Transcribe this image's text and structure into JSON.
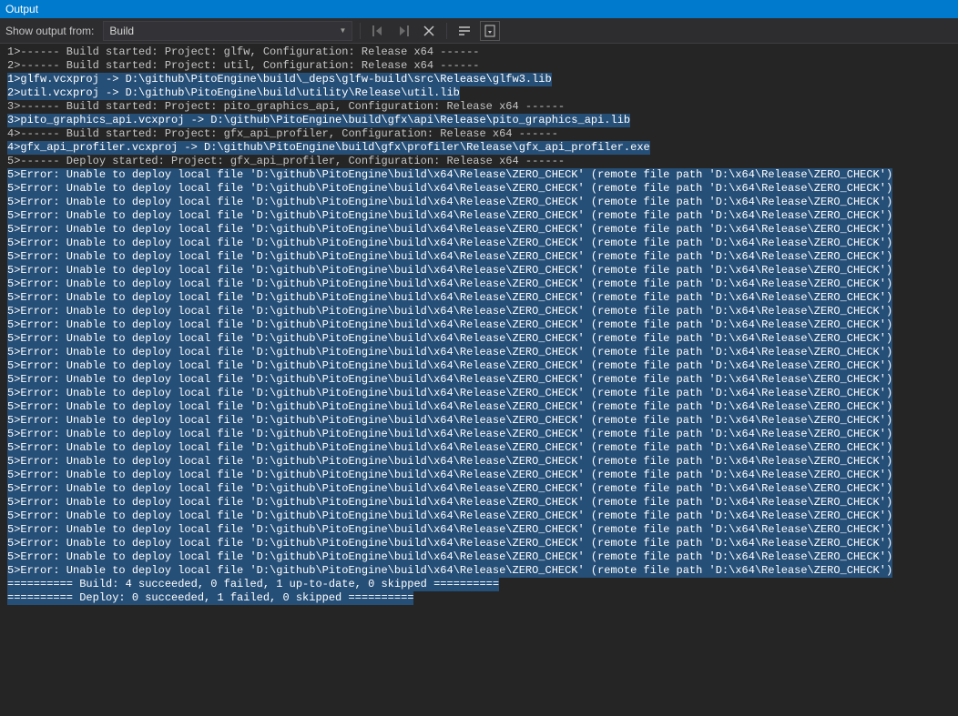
{
  "window": {
    "title": "Output"
  },
  "toolbar": {
    "label": "Show output from:",
    "dropdown_value": "Build"
  },
  "lines": [
    {
      "sel": false,
      "text": "1>------ Build started: Project: glfw, Configuration: Release x64 ------"
    },
    {
      "sel": false,
      "text": "2>------ Build started: Project: util, Configuration: Release x64 ------"
    },
    {
      "sel": true,
      "text": "1>glfw.vcxproj -> D:\\github\\PitoEngine\\build\\_deps\\glfw-build\\src\\Release\\glfw3.lib"
    },
    {
      "sel": true,
      "text": "2>util.vcxproj -> D:\\github\\PitoEngine\\build\\utility\\Release\\util.lib"
    },
    {
      "sel": false,
      "text": "3>------ Build started: Project: pito_graphics_api, Configuration: Release x64 ------"
    },
    {
      "sel": true,
      "text": "3>pito_graphics_api.vcxproj -> D:\\github\\PitoEngine\\build\\gfx\\api\\Release\\pito_graphics_api.lib"
    },
    {
      "sel": false,
      "text": "4>------ Build started: Project: gfx_api_profiler, Configuration: Release x64 ------"
    },
    {
      "sel": true,
      "text": "4>gfx_api_profiler.vcxproj -> D:\\github\\PitoEngine\\build\\gfx\\profiler\\Release\\gfx_api_profiler.exe"
    },
    {
      "sel": false,
      "text": "5>------ Deploy started: Project: gfx_api_profiler, Configuration: Release x64 ------"
    },
    {
      "sel": true,
      "text": "5>Error: Unable to deploy local file 'D:\\github\\PitoEngine\\build\\x64\\Release\\ZERO_CHECK' (remote file path 'D:\\x64\\Release\\ZERO_CHECK')"
    },
    {
      "sel": true,
      "text": "5>Error: Unable to deploy local file 'D:\\github\\PitoEngine\\build\\x64\\Release\\ZERO_CHECK' (remote file path 'D:\\x64\\Release\\ZERO_CHECK')"
    },
    {
      "sel": true,
      "text": "5>Error: Unable to deploy local file 'D:\\github\\PitoEngine\\build\\x64\\Release\\ZERO_CHECK' (remote file path 'D:\\x64\\Release\\ZERO_CHECK')"
    },
    {
      "sel": true,
      "text": "5>Error: Unable to deploy local file 'D:\\github\\PitoEngine\\build\\x64\\Release\\ZERO_CHECK' (remote file path 'D:\\x64\\Release\\ZERO_CHECK')"
    },
    {
      "sel": true,
      "text": "5>Error: Unable to deploy local file 'D:\\github\\PitoEngine\\build\\x64\\Release\\ZERO_CHECK' (remote file path 'D:\\x64\\Release\\ZERO_CHECK')"
    },
    {
      "sel": true,
      "text": "5>Error: Unable to deploy local file 'D:\\github\\PitoEngine\\build\\x64\\Release\\ZERO_CHECK' (remote file path 'D:\\x64\\Release\\ZERO_CHECK')"
    },
    {
      "sel": true,
      "text": "5>Error: Unable to deploy local file 'D:\\github\\PitoEngine\\build\\x64\\Release\\ZERO_CHECK' (remote file path 'D:\\x64\\Release\\ZERO_CHECK')"
    },
    {
      "sel": true,
      "text": "5>Error: Unable to deploy local file 'D:\\github\\PitoEngine\\build\\x64\\Release\\ZERO_CHECK' (remote file path 'D:\\x64\\Release\\ZERO_CHECK')"
    },
    {
      "sel": true,
      "text": "5>Error: Unable to deploy local file 'D:\\github\\PitoEngine\\build\\x64\\Release\\ZERO_CHECK' (remote file path 'D:\\x64\\Release\\ZERO_CHECK')"
    },
    {
      "sel": true,
      "text": "5>Error: Unable to deploy local file 'D:\\github\\PitoEngine\\build\\x64\\Release\\ZERO_CHECK' (remote file path 'D:\\x64\\Release\\ZERO_CHECK')"
    },
    {
      "sel": true,
      "text": "5>Error: Unable to deploy local file 'D:\\github\\PitoEngine\\build\\x64\\Release\\ZERO_CHECK' (remote file path 'D:\\x64\\Release\\ZERO_CHECK')"
    },
    {
      "sel": true,
      "text": "5>Error: Unable to deploy local file 'D:\\github\\PitoEngine\\build\\x64\\Release\\ZERO_CHECK' (remote file path 'D:\\x64\\Release\\ZERO_CHECK')"
    },
    {
      "sel": true,
      "text": "5>Error: Unable to deploy local file 'D:\\github\\PitoEngine\\build\\x64\\Release\\ZERO_CHECK' (remote file path 'D:\\x64\\Release\\ZERO_CHECK')"
    },
    {
      "sel": true,
      "text": "5>Error: Unable to deploy local file 'D:\\github\\PitoEngine\\build\\x64\\Release\\ZERO_CHECK' (remote file path 'D:\\x64\\Release\\ZERO_CHECK')"
    },
    {
      "sel": true,
      "text": "5>Error: Unable to deploy local file 'D:\\github\\PitoEngine\\build\\x64\\Release\\ZERO_CHECK' (remote file path 'D:\\x64\\Release\\ZERO_CHECK')"
    },
    {
      "sel": true,
      "text": "5>Error: Unable to deploy local file 'D:\\github\\PitoEngine\\build\\x64\\Release\\ZERO_CHECK' (remote file path 'D:\\x64\\Release\\ZERO_CHECK')"
    },
    {
      "sel": true,
      "text": "5>Error: Unable to deploy local file 'D:\\github\\PitoEngine\\build\\x64\\Release\\ZERO_CHECK' (remote file path 'D:\\x64\\Release\\ZERO_CHECK')"
    },
    {
      "sel": true,
      "text": "5>Error: Unable to deploy local file 'D:\\github\\PitoEngine\\build\\x64\\Release\\ZERO_CHECK' (remote file path 'D:\\x64\\Release\\ZERO_CHECK')"
    },
    {
      "sel": true,
      "text": "5>Error: Unable to deploy local file 'D:\\github\\PitoEngine\\build\\x64\\Release\\ZERO_CHECK' (remote file path 'D:\\x64\\Release\\ZERO_CHECK')"
    },
    {
      "sel": true,
      "text": "5>Error: Unable to deploy local file 'D:\\github\\PitoEngine\\build\\x64\\Release\\ZERO_CHECK' (remote file path 'D:\\x64\\Release\\ZERO_CHECK')"
    },
    {
      "sel": true,
      "text": "5>Error: Unable to deploy local file 'D:\\github\\PitoEngine\\build\\x64\\Release\\ZERO_CHECK' (remote file path 'D:\\x64\\Release\\ZERO_CHECK')"
    },
    {
      "sel": true,
      "text": "5>Error: Unable to deploy local file 'D:\\github\\PitoEngine\\build\\x64\\Release\\ZERO_CHECK' (remote file path 'D:\\x64\\Release\\ZERO_CHECK')"
    },
    {
      "sel": true,
      "text": "5>Error: Unable to deploy local file 'D:\\github\\PitoEngine\\build\\x64\\Release\\ZERO_CHECK' (remote file path 'D:\\x64\\Release\\ZERO_CHECK')"
    },
    {
      "sel": true,
      "text": "5>Error: Unable to deploy local file 'D:\\github\\PitoEngine\\build\\x64\\Release\\ZERO_CHECK' (remote file path 'D:\\x64\\Release\\ZERO_CHECK')"
    },
    {
      "sel": true,
      "text": "5>Error: Unable to deploy local file 'D:\\github\\PitoEngine\\build\\x64\\Release\\ZERO_CHECK' (remote file path 'D:\\x64\\Release\\ZERO_CHECK')"
    },
    {
      "sel": true,
      "text": "5>Error: Unable to deploy local file 'D:\\github\\PitoEngine\\build\\x64\\Release\\ZERO_CHECK' (remote file path 'D:\\x64\\Release\\ZERO_CHECK')"
    },
    {
      "sel": true,
      "text": "5>Error: Unable to deploy local file 'D:\\github\\PitoEngine\\build\\x64\\Release\\ZERO_CHECK' (remote file path 'D:\\x64\\Release\\ZERO_CHECK')"
    },
    {
      "sel": true,
      "text": "5>Error: Unable to deploy local file 'D:\\github\\PitoEngine\\build\\x64\\Release\\ZERO_CHECK' (remote file path 'D:\\x64\\Release\\ZERO_CHECK')"
    },
    {
      "sel": true,
      "text": "5>Error: Unable to deploy local file 'D:\\github\\PitoEngine\\build\\x64\\Release\\ZERO_CHECK' (remote file path 'D:\\x64\\Release\\ZERO_CHECK')"
    },
    {
      "sel": true,
      "text": "5>Error: Unable to deploy local file 'D:\\github\\PitoEngine\\build\\x64\\Release\\ZERO_CHECK' (remote file path 'D:\\x64\\Release\\ZERO_CHECK')"
    },
    {
      "sel": true,
      "text": "========== Build: 4 succeeded, 0 failed, 1 up-to-date, 0 skipped =========="
    },
    {
      "sel": true,
      "text": "========== Deploy: 0 succeeded, 1 failed, 0 skipped =========="
    }
  ]
}
